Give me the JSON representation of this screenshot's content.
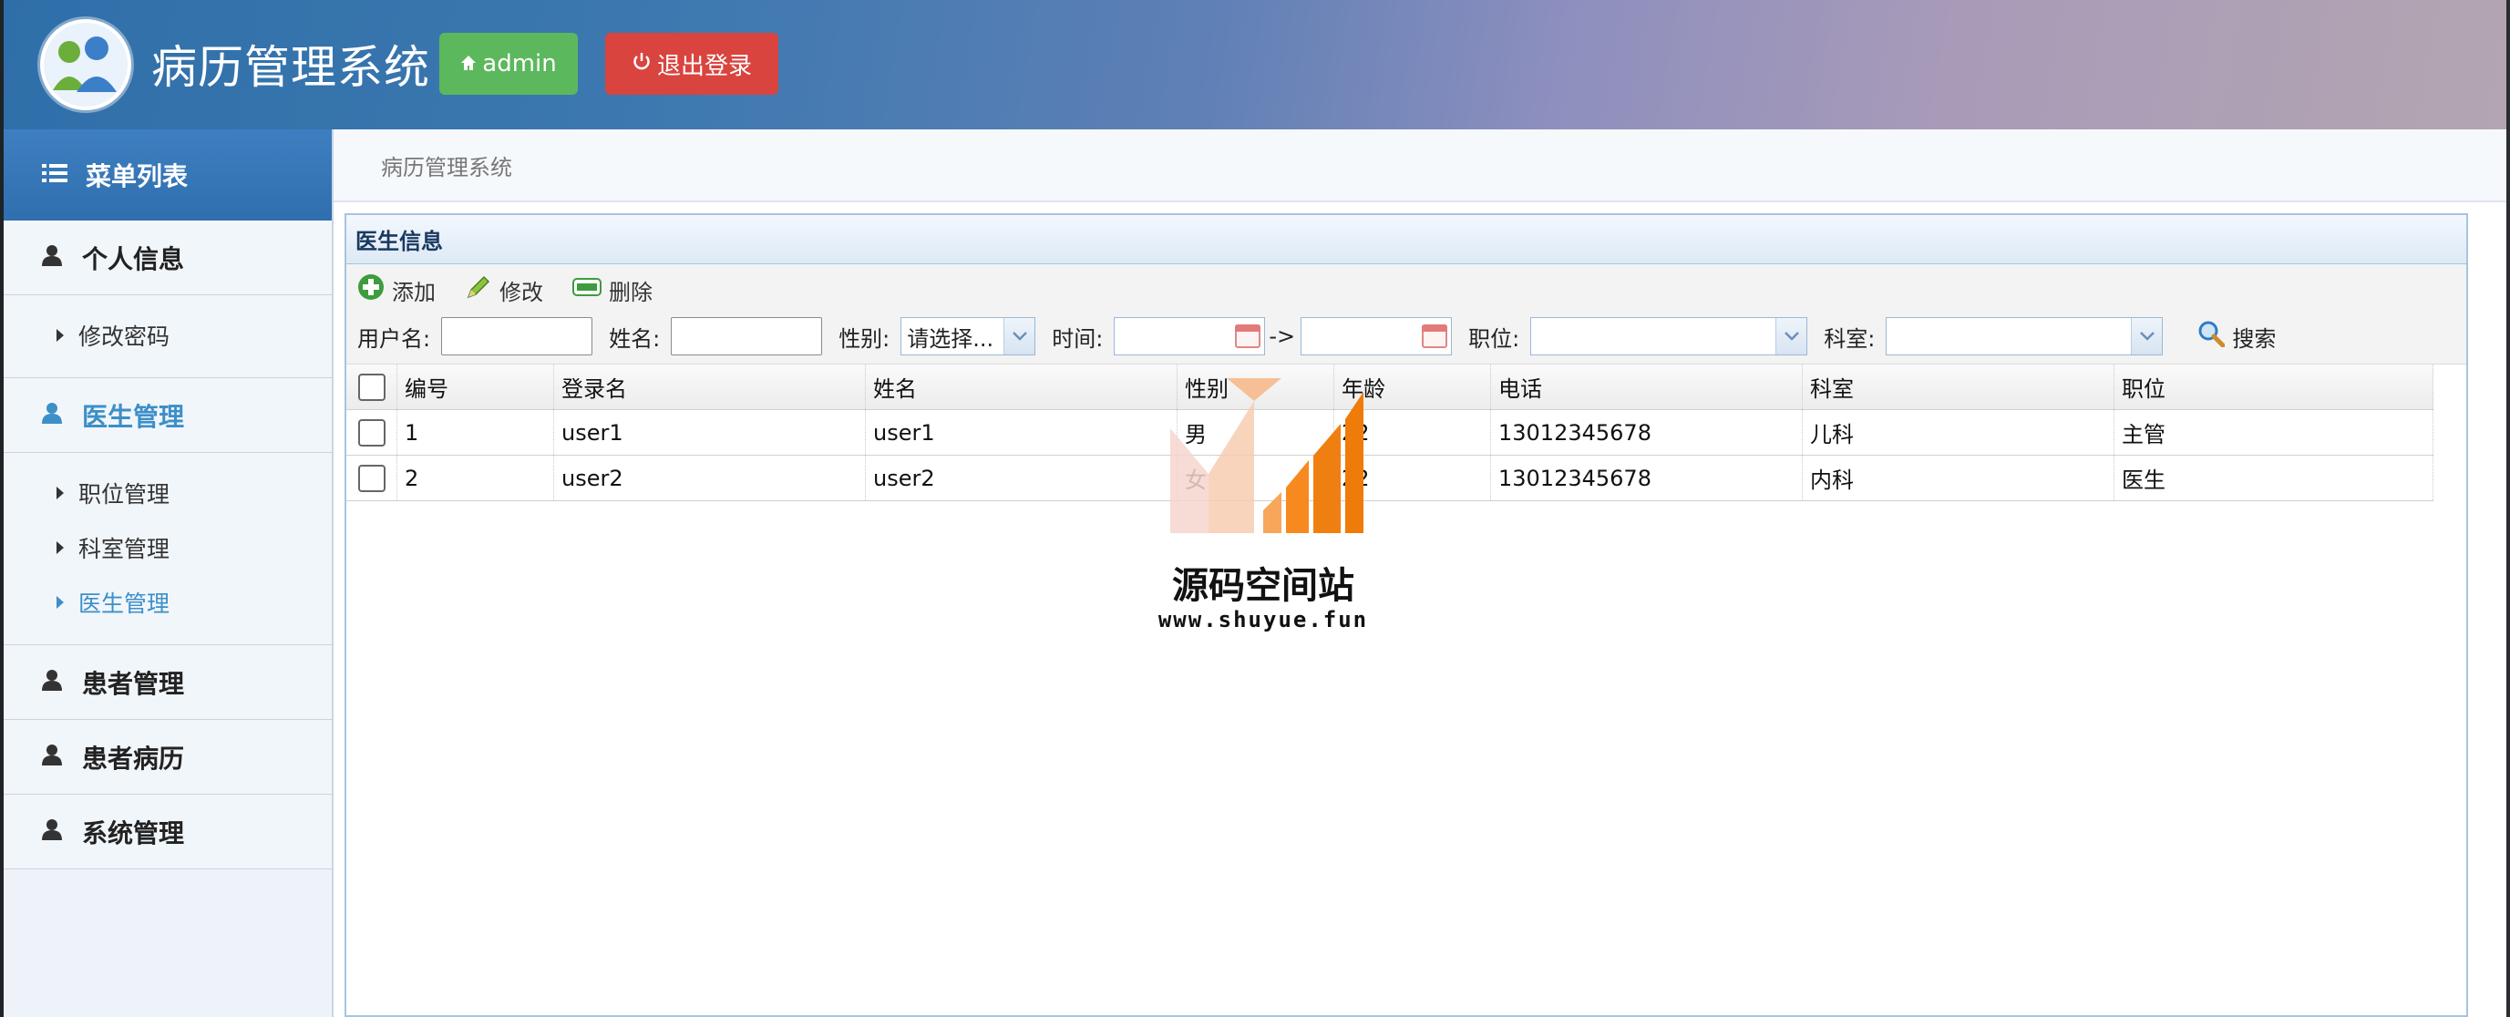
{
  "header": {
    "title": "病历管理系统",
    "admin_label": "admin",
    "logout_label": "退出登录"
  },
  "sidebar": {
    "menu_title": "菜单列表",
    "groups": [
      {
        "label": "个人信息",
        "items": [
          {
            "label": "修改密码"
          }
        ]
      },
      {
        "label": "医生管理",
        "items": [
          {
            "label": "职位管理"
          },
          {
            "label": "科室管理"
          },
          {
            "label": "医生管理"
          }
        ]
      },
      {
        "label": "患者管理"
      },
      {
        "label": "患者病历"
      },
      {
        "label": "系统管理"
      }
    ]
  },
  "breadcrumb": "病历管理系统",
  "panel": {
    "title": "医生信息",
    "actions": {
      "add": "添加",
      "edit": "修改",
      "delete": "删除"
    },
    "filters": {
      "username_label": "用户名:",
      "name_label": "姓名:",
      "gender_label": "性别:",
      "gender_value": "请选择...",
      "time_label": "时间:",
      "arrow": "->",
      "position_label": "职位:",
      "dept_label": "科室:",
      "search_label": "搜索"
    },
    "table": {
      "columns": [
        "编号",
        "登录名",
        "姓名",
        "性别",
        "年龄",
        "电话",
        "科室",
        "职位"
      ],
      "rows": [
        [
          "1",
          "user1",
          "user1",
          "男",
          "22",
          "13012345678",
          "儿科",
          "主管"
        ],
        [
          "2",
          "user2",
          "user2",
          "女",
          "22",
          "13012345678",
          "内科",
          "医生"
        ]
      ]
    }
  },
  "watermark": {
    "title": "源码空间站",
    "url": "www.shuyue.fun"
  },
  "colors": {
    "admin_button": "#5cb85c",
    "logout_button": "#d9443f",
    "sidebar_active": "#3d8fc8",
    "menu_header": "#3579b8"
  }
}
